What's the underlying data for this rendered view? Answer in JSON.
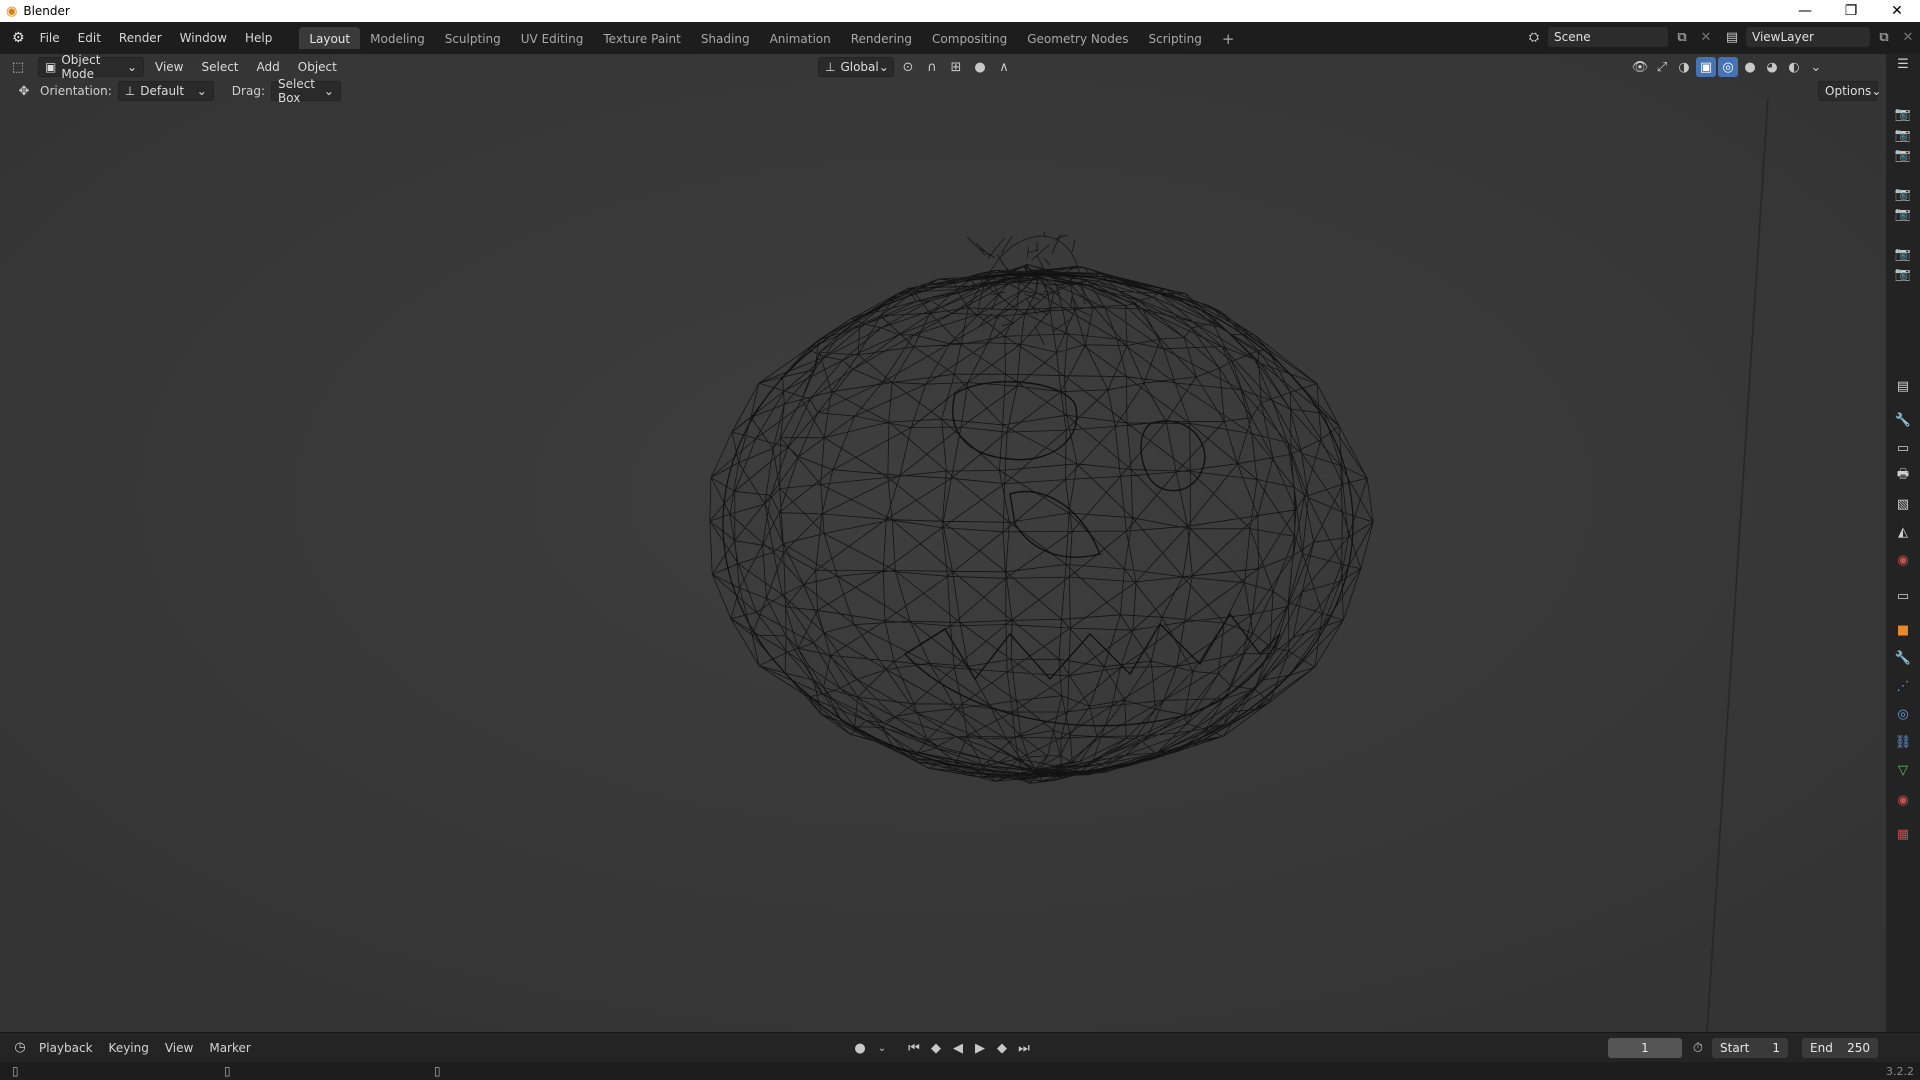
{
  "window": {
    "title": "Blender",
    "minimize": "—",
    "maximize": "❐",
    "close": "✕"
  },
  "menu": [
    "File",
    "Edit",
    "Render",
    "Window",
    "Help"
  ],
  "workspaces": [
    "Layout",
    "Modeling",
    "Sculpting",
    "UV Editing",
    "Texture Paint",
    "Shading",
    "Animation",
    "Rendering",
    "Compositing",
    "Geometry Nodes",
    "Scripting"
  ],
  "active_workspace": "Layout",
  "add_workspace": "+",
  "scene": {
    "name": "Scene"
  },
  "view_layer": {
    "name": "ViewLayer"
  },
  "viewport_header": {
    "mode": "Object Mode",
    "menus": [
      "View",
      "Select",
      "Add",
      "Object"
    ],
    "transform_orientation": "Global"
  },
  "tool_options": {
    "orientation_label": "Orientation:",
    "orientation_value": "Default",
    "drag_label": "Drag:",
    "drag_value": "Select Box",
    "options_label": "Options"
  },
  "timeline": {
    "menus": [
      "Playback",
      "Keying",
      "View",
      "Marker"
    ],
    "current_frame": "1",
    "start_label": "Start",
    "start_value": "1",
    "end_label": "End",
    "end_value": "250"
  },
  "status": {
    "version": "3.2.2"
  },
  "colors": {
    "accent": "#4772b3",
    "menu_bg": "#1d1d1d",
    "viewport_bg": "#393939",
    "wire": "#0e0e0e"
  }
}
